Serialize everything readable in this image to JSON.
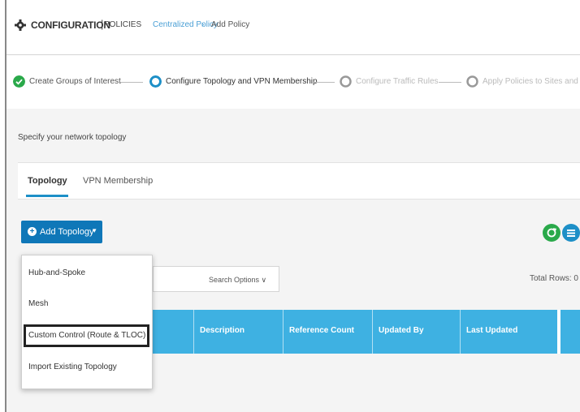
{
  "header": {
    "title": "CONFIGURATION",
    "separator": "|",
    "section": "POLICIES",
    "breadcrumb_link": "Centralized Policy",
    "breadcrumb_arrow": "›",
    "breadcrumb_current": "Add Policy"
  },
  "stepper": {
    "steps": [
      {
        "label": "Create Groups of Interest",
        "state": "done"
      },
      {
        "label": "Configure Topology and VPN Membership",
        "state": "current"
      },
      {
        "label": "Configure Traffic Rules",
        "state": "pending"
      },
      {
        "label": "Apply Policies to Sites and VPNs",
        "state": "pending"
      }
    ]
  },
  "page": {
    "specify_text": "Specify your network topology"
  },
  "tabs": [
    {
      "label": "Topology",
      "active": true
    },
    {
      "label": "VPN Membership",
      "active": false
    }
  ],
  "toolbar": {
    "add_label": "Add Topology",
    "add_caret": "▾",
    "add_plus": "+",
    "refresh_icon": "refresh-icon",
    "menu_icon": "list-menu-icon"
  },
  "search": {
    "options_label": "Search Options ∨",
    "total_rows": "Total Rows: 0"
  },
  "table": {
    "columns": [
      "Description",
      "Reference Count",
      "Updated By",
      "Last Updated"
    ]
  },
  "dropdown": {
    "items": [
      "Hub-and-Spoke",
      "Mesh",
      "Custom Control (Route & TLOC)",
      "Import Existing Topology"
    ]
  },
  "colors": {
    "accent": "#0f77b8",
    "table_header": "#3eb1e2",
    "success": "#2aa94a",
    "link": "#4a9fd5"
  }
}
